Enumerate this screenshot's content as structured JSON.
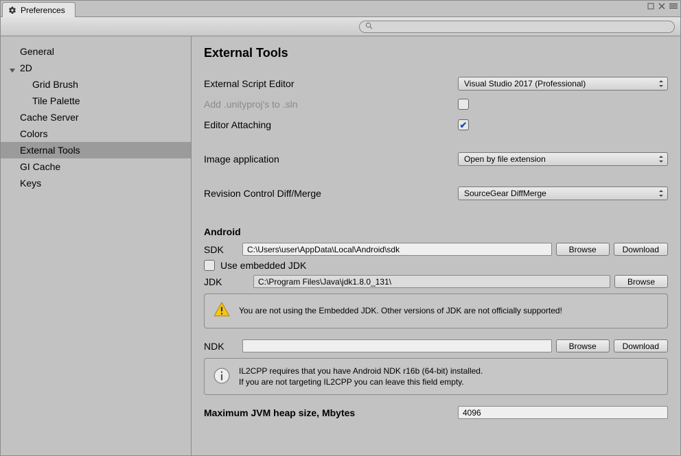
{
  "tab_title": "Preferences",
  "search_placeholder": "",
  "sidebar": {
    "items": [
      {
        "label": "General"
      },
      {
        "label": "2D"
      },
      {
        "label": "Grid Brush"
      },
      {
        "label": "Tile Palette"
      },
      {
        "label": "Cache Server"
      },
      {
        "label": "Colors"
      },
      {
        "label": "External Tools"
      },
      {
        "label": "GI Cache"
      },
      {
        "label": "Keys"
      }
    ]
  },
  "page": {
    "title": "External Tools",
    "script_editor_label": "External Script Editor",
    "script_editor_value": "Visual Studio 2017 (Professional)",
    "add_unityproj_label": "Add .unityproj's to .sln",
    "editor_attaching_label": "Editor Attaching",
    "image_app_label": "Image application",
    "image_app_value": "Open by file extension",
    "revision_label": "Revision Control Diff/Merge",
    "revision_value": "SourceGear DiffMerge",
    "android_title": "Android",
    "sdk_label": "SDK",
    "sdk_value": "C:\\Users\\user\\AppData\\Local\\Android\\sdk",
    "browse_label": "Browse",
    "download_label": "Download",
    "embedded_jdk_label": "Use embedded JDK",
    "jdk_label": "JDK",
    "jdk_value": "C:\\Program Files\\Java\\jdk1.8.0_131\\",
    "jdk_warning": "You are not using the Embedded JDK. Other versions of JDK are not officially supported!",
    "ndk_label": "NDK",
    "ndk_value": "",
    "il2cpp_info_1": "IL2CPP requires that you have Android NDK r16b (64-bit) installed.",
    "il2cpp_info_2": "If you are not targeting IL2CPP you can leave this field empty.",
    "heap_label": "Maximum JVM heap size, Mbytes",
    "heap_value": "4096"
  }
}
